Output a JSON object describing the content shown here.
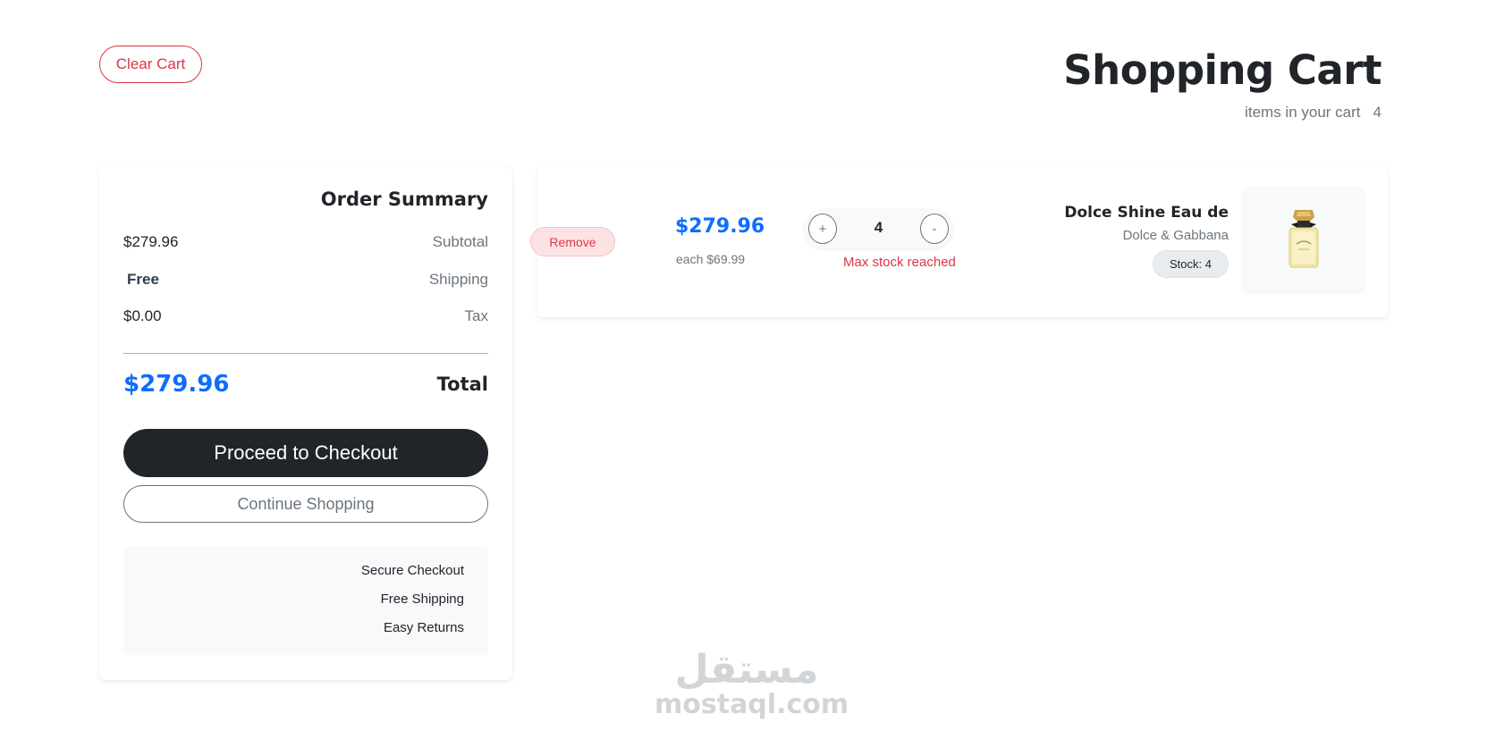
{
  "header": {
    "clear_cart_label": "Clear Cart",
    "title": "Shopping Cart",
    "items_label": "items in your cart",
    "items_count": "4"
  },
  "summary": {
    "title": "Order Summary",
    "rows": [
      {
        "value": "$279.96",
        "label": "Subtotal"
      },
      {
        "value": "Free",
        "label": "Shipping"
      },
      {
        "value": "$0.00",
        "label": "Tax"
      }
    ],
    "total": {
      "value": "$279.96",
      "label": "Total"
    },
    "checkout_label": "Proceed to Checkout",
    "continue_label": "Continue Shopping",
    "features": [
      "Secure Checkout",
      "Free Shipping",
      "Easy Returns"
    ]
  },
  "item": {
    "remove_label": "Remove",
    "price": "$279.96",
    "each": "each $69.99",
    "plus": "+",
    "quantity": "4",
    "minus": "-",
    "max_stock_msg": "Max stock reached",
    "name": "Dolce Shine Eau de",
    "brand": "Dolce & Gabbana",
    "stock": "Stock: 4",
    "image_icon": "perfume-bottle-icon"
  },
  "watermark": {
    "arabic": "مستقل",
    "latin": "mostaql.com"
  },
  "colors": {
    "accent_blue": "#0d6efd",
    "danger_red": "#dc3545",
    "dark": "#212529",
    "muted": "#6c757d"
  }
}
